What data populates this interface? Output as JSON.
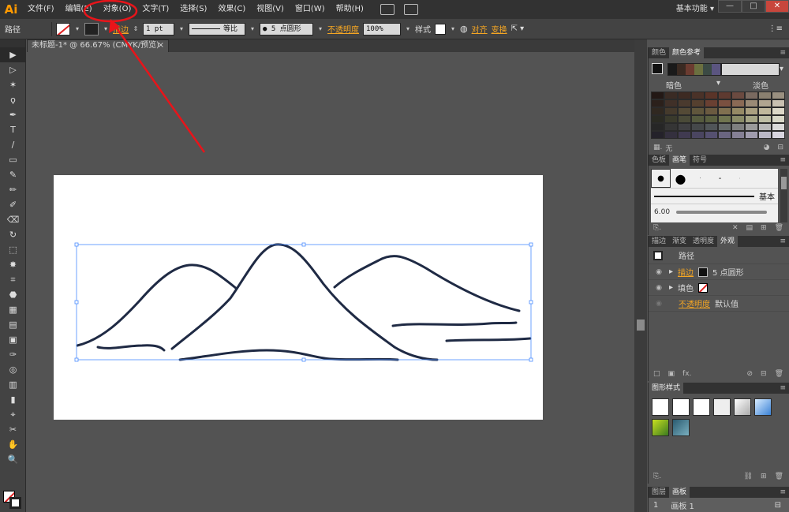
{
  "app": {
    "logo": "Ai"
  },
  "menu": [
    "文件(F)",
    "编辑(E)",
    "对象(O)",
    "文字(T)",
    "选择(S)",
    "效果(C)",
    "视图(V)",
    "窗口(W)",
    "帮助(H)"
  ],
  "workspace": "基本功能",
  "window_buttons": [
    "—",
    "□",
    "✕"
  ],
  "control": {
    "selection_label": "路径",
    "stroke_label": "描边",
    "stroke_weight": "1 pt",
    "profile": "等比",
    "brush": "● 5 点圆形",
    "opacity_label": "不透明度",
    "opacity": "100%",
    "style_label": "样式",
    "align_label": "对齐",
    "transform_label": "变换"
  },
  "document": {
    "tab": "未标题-1* @ 66.67% (CMYK/预览)",
    "close": "×"
  },
  "tools": [
    "▶",
    "▷",
    "✶",
    "ϙ",
    "✒",
    "T",
    "/",
    "▭",
    "✎",
    "✏",
    "✐",
    "⌫",
    "↻",
    "⬚",
    "✸",
    "⌗",
    "⬣",
    "▦",
    "▤",
    "▣",
    "✑",
    "◎",
    "▥",
    "▮",
    "⌖",
    "✂",
    "✋",
    "🔍"
  ],
  "panels": {
    "color_tabs": [
      "颜色",
      "颜色参考"
    ],
    "color_groups": [
      "暗色",
      "淡色"
    ],
    "none_label": "无",
    "brush_tabs": [
      "色板",
      "画笔",
      "符号"
    ],
    "brush_basic": "基本",
    "brush_size": "6.00",
    "appearance_tabs": [
      "描边",
      "渐变",
      "透明度",
      "外观"
    ],
    "appearance_title": "路径",
    "appearance_stroke": "描边",
    "appearance_stroke_value": "5 点圆形",
    "appearance_fill": "填色",
    "appearance_opacity": "不透明度",
    "appearance_opacity_value": "默认值",
    "graphic_styles_tab": "图形样式",
    "layers_tabs": [
      "图层",
      "画板"
    ],
    "artboard_row_num": "1",
    "artboard_row_name": "画板 1"
  },
  "colors": {
    "accent": "#f5a623",
    "annotation": "#e8141a",
    "path": "#1f2a44",
    "selection": "#4a8cff"
  },
  "swatches_top": [
    "#1a1a1a",
    "#3a2a22",
    "#6b3b30",
    "#6b7040",
    "#3b4a44",
    "#5b5580"
  ],
  "swatch_grid": [
    [
      "#231815",
      "#3a2b24",
      "#3d2a22",
      "#4a3228",
      "#5a3428",
      "#5e3a30",
      "#6b4a40",
      "#7a6a60",
      "#8a8070",
      "#9a9080"
    ],
    [
      "#2b201b",
      "#403028",
      "#4a3a2e",
      "#55402f",
      "#6a4032",
      "#7a5040",
      "#8a6a55",
      "#9a8a75",
      "#b0a590",
      "#c8c0b0"
    ],
    [
      "#302820",
      "#453a2c",
      "#544a36",
      "#60563c",
      "#6a5a40",
      "#807050",
      "#958a65",
      "#aaa080",
      "#c0b89c",
      "#dcd8c8"
    ],
    [
      "#2a2a22",
      "#3a3a2c",
      "#4a4a38",
      "#555a3e",
      "#5a6040",
      "#707550",
      "#8a8c68",
      "#a5a585",
      "#bebea5",
      "#d8d8c8"
    ],
    [
      "#262626",
      "#353535",
      "#3f3f42",
      "#45484a",
      "#505558",
      "#656a6a",
      "#7f8080",
      "#9a9a9a",
      "#b8b8b8",
      "#dadada"
    ],
    [
      "#24222a",
      "#34303e",
      "#403a50",
      "#4a4560",
      "#555070",
      "#6a6580",
      "#858095",
      "#a09cae",
      "#bab8c6",
      "#d8d6e0"
    ]
  ]
}
